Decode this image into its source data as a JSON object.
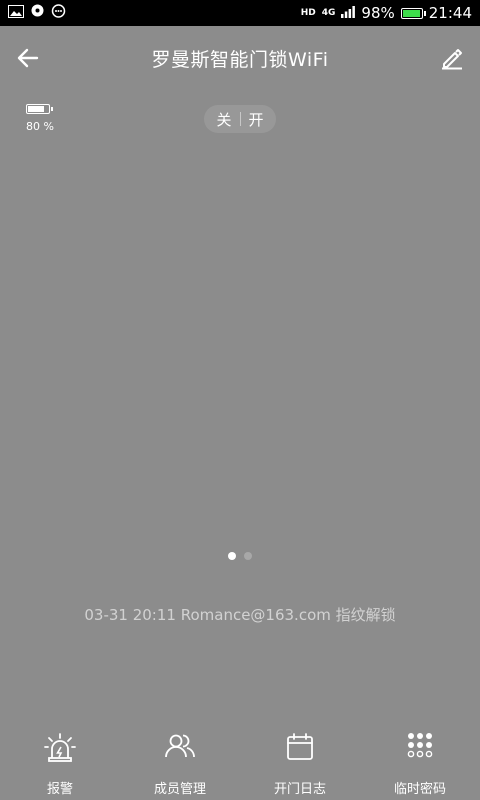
{
  "status_bar": {
    "hd": "HD",
    "network": "4G",
    "battery_pct": "98%",
    "battery_level": 0.98,
    "time": "21:44"
  },
  "header": {
    "title": "罗曼斯智能门锁WiFi"
  },
  "lock_battery": {
    "label": "80 %",
    "level": 0.8
  },
  "toggle": {
    "off": "关",
    "on": "开"
  },
  "pager": {
    "count": 2,
    "active": 0
  },
  "log": {
    "text": "03-31 20:11  Romance@163.com 指纹解锁"
  },
  "nav": {
    "items": [
      {
        "label": "报警",
        "icon": "alarm-icon"
      },
      {
        "label": "成员管理",
        "icon": "members-icon"
      },
      {
        "label": "开门日志",
        "icon": "calendar-icon"
      },
      {
        "label": "临时密码",
        "icon": "keypad-icon"
      }
    ]
  },
  "colors": {
    "background": "#8c8c8c",
    "status_bar": "#000000",
    "battery_green": "#3ddc4a"
  }
}
